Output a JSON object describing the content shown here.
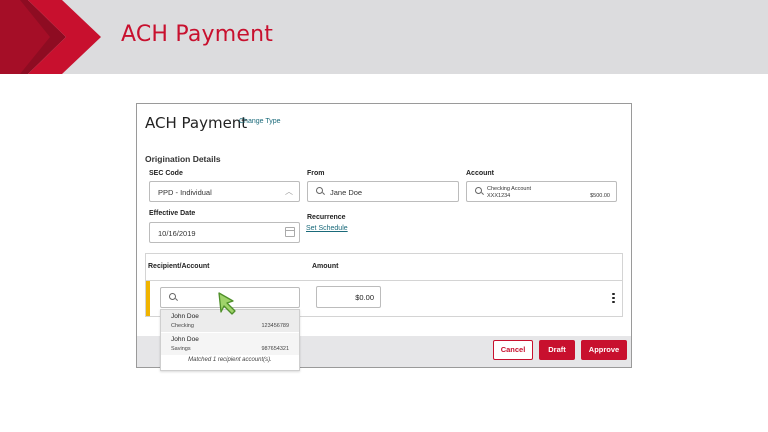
{
  "banner": {
    "title": "ACH Payment",
    "accent_color": "#c8102e"
  },
  "form": {
    "title": "ACH Payment",
    "change_type_link": "Change Type",
    "section_title": "Origination Details",
    "sec_code": {
      "label": "SEC Code",
      "value": "PPD - Individual"
    },
    "from": {
      "label": "From",
      "value": "Jane Doe"
    },
    "account": {
      "label": "Account",
      "name": "Checking Account",
      "number": "XXX1234",
      "balance": "$500.00"
    },
    "effective_date": {
      "label": "Effective Date",
      "value": "10/16/2019"
    },
    "recurrence": {
      "label": "Recurrence",
      "link": "Set Schedule"
    }
  },
  "grid": {
    "headers": [
      "Recipient/Account",
      "Amount"
    ],
    "row": {
      "amount": "$0.00"
    }
  },
  "dropdown": {
    "options": [
      {
        "name": "John Doe",
        "type": "Checking",
        "account": "123456789"
      },
      {
        "name": "John Doe",
        "type": "Savings",
        "account": "987654321"
      }
    ],
    "match_text": "Matched 1 recipient account(s)."
  },
  "buttons": {
    "cancel": "Cancel",
    "draft": "Draft",
    "approve": "Approve"
  }
}
